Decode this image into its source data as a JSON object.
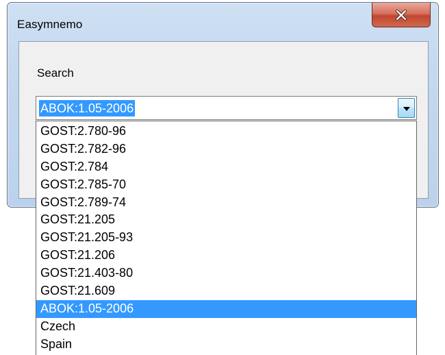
{
  "window": {
    "title": "Easymnemo"
  },
  "search": {
    "label": "Search",
    "value": "ABOK:1.05-2006"
  },
  "dropdown": {
    "items": [
      "GOST:2.780-96",
      "GOST:2.782-96",
      "GOST:2.784",
      "GOST:2.785-70",
      "GOST:2.789-74",
      "GOST:21.205",
      "GOST:21.205-93",
      "GOST:21.206",
      "GOST:21.403-80",
      "GOST:21.609",
      "ABOK:1.05-2006",
      "Czech",
      "Spain"
    ],
    "selected": "ABOK:1.05-2006"
  },
  "icons": {
    "close": "close-icon",
    "dropdown_arrow": "chevron-down-icon"
  },
  "colors": {
    "selection": "#3399ff",
    "close_button": "#c2462f",
    "window_frame": "#bcd2ec"
  }
}
